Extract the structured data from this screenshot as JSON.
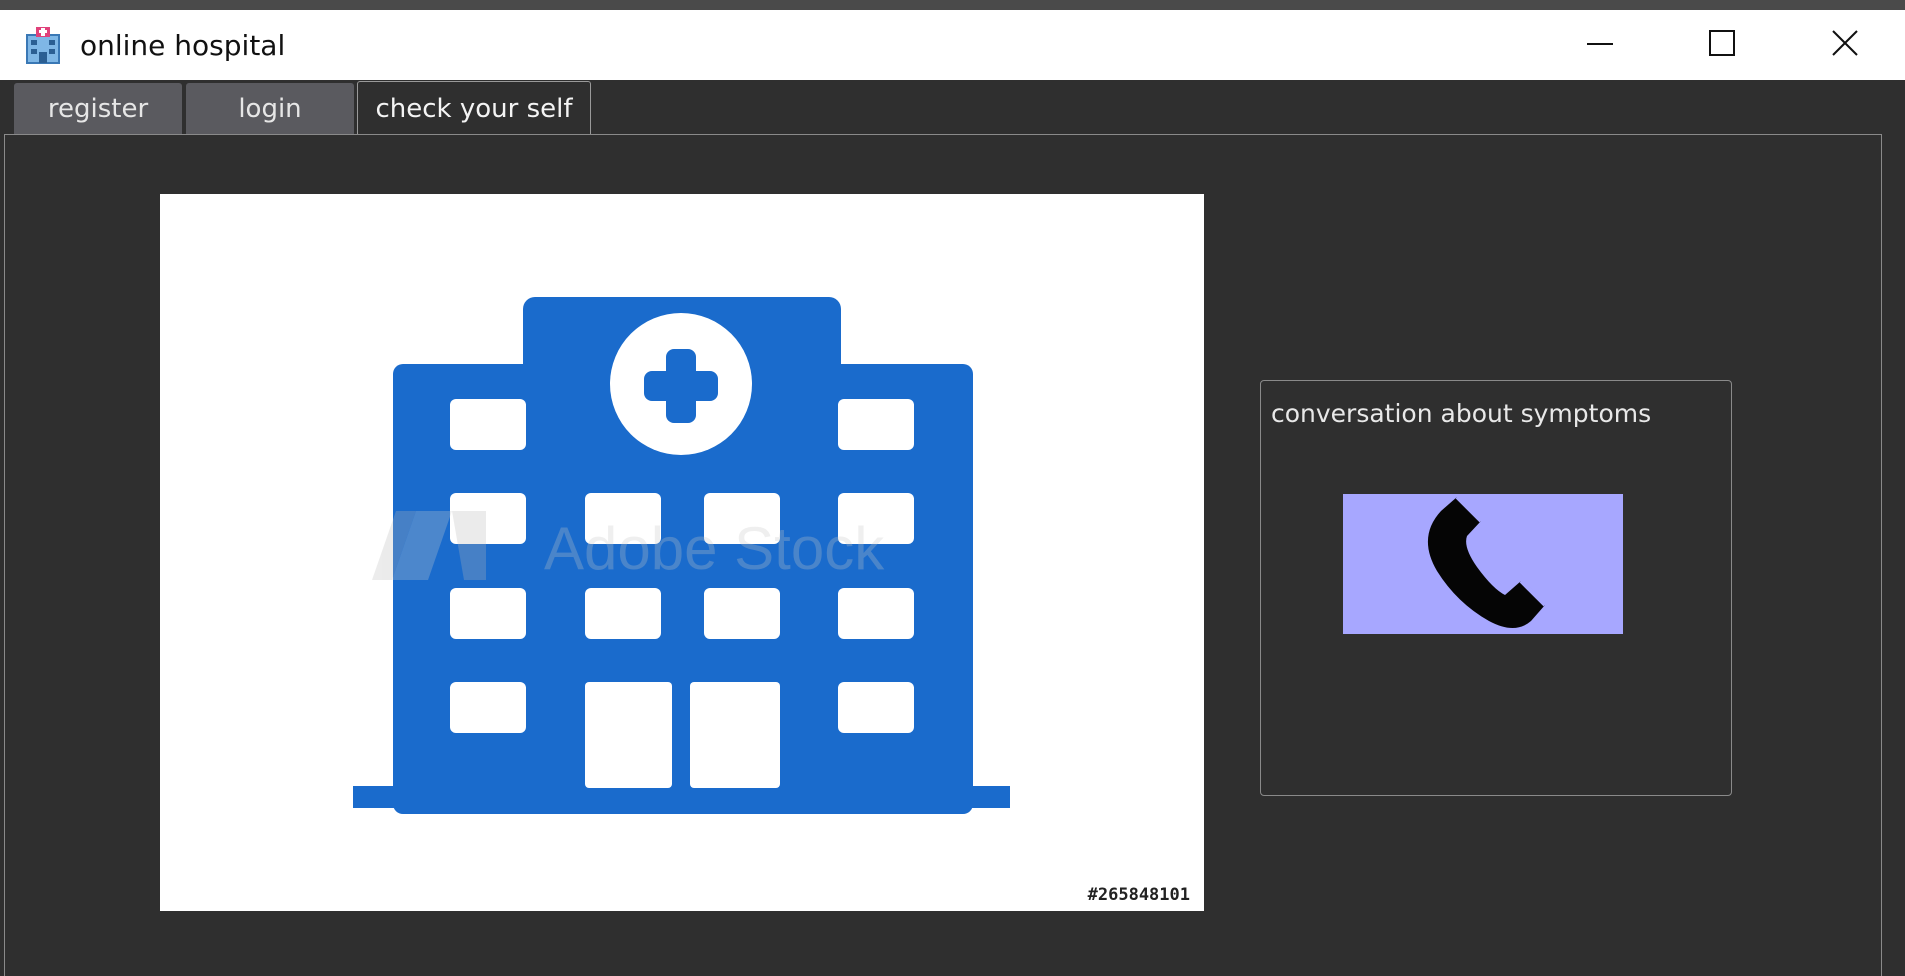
{
  "window": {
    "title": "online hospital",
    "icon": "hospital-app-icon",
    "controls": [
      "minimize-icon",
      "maximize-icon",
      "close-icon"
    ]
  },
  "tabs": [
    {
      "label": "register",
      "active": false
    },
    {
      "label": "login",
      "active": false
    },
    {
      "label": "check your self",
      "active": true
    }
  ],
  "main_image": {
    "icon": "hospital-building-icon",
    "watermark": "Adobe Stock",
    "stock_id": "#265848101",
    "color": "#1a6bcc"
  },
  "conversation": {
    "title": "conversation about symptoms",
    "button_icon": "phone-icon",
    "button_color": "#a7a7ff"
  }
}
